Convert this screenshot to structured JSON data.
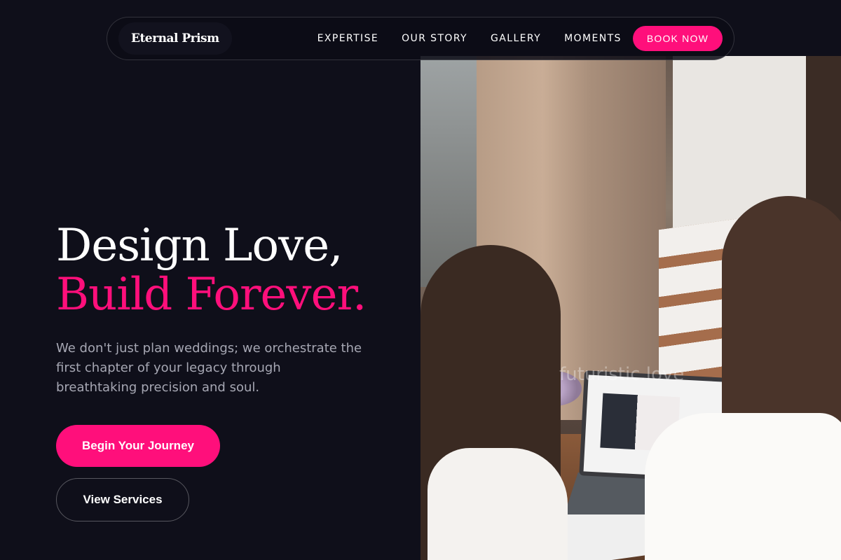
{
  "nav": {
    "brand": "Eternal Prism",
    "links": [
      "EXPERTISE",
      "OUR STORY",
      "GALLERY",
      "MOMENTS"
    ],
    "cta": "BOOK NOW"
  },
  "hero": {
    "headline_line1": "Design Love,",
    "headline_line2": "Build Forever.",
    "lede": "We don't just plan weddings; we orchestrate the first chapter of your legacy through breathtaking precision and soul.",
    "primary_cta": "Begin Your Journey",
    "secondary_cta": "View Services",
    "image_watermark": "futuristic.love"
  },
  "colors": {
    "background": "#0f0f1a",
    "accent": "#ff0f7b",
    "muted_text": "#a6a7b3"
  }
}
